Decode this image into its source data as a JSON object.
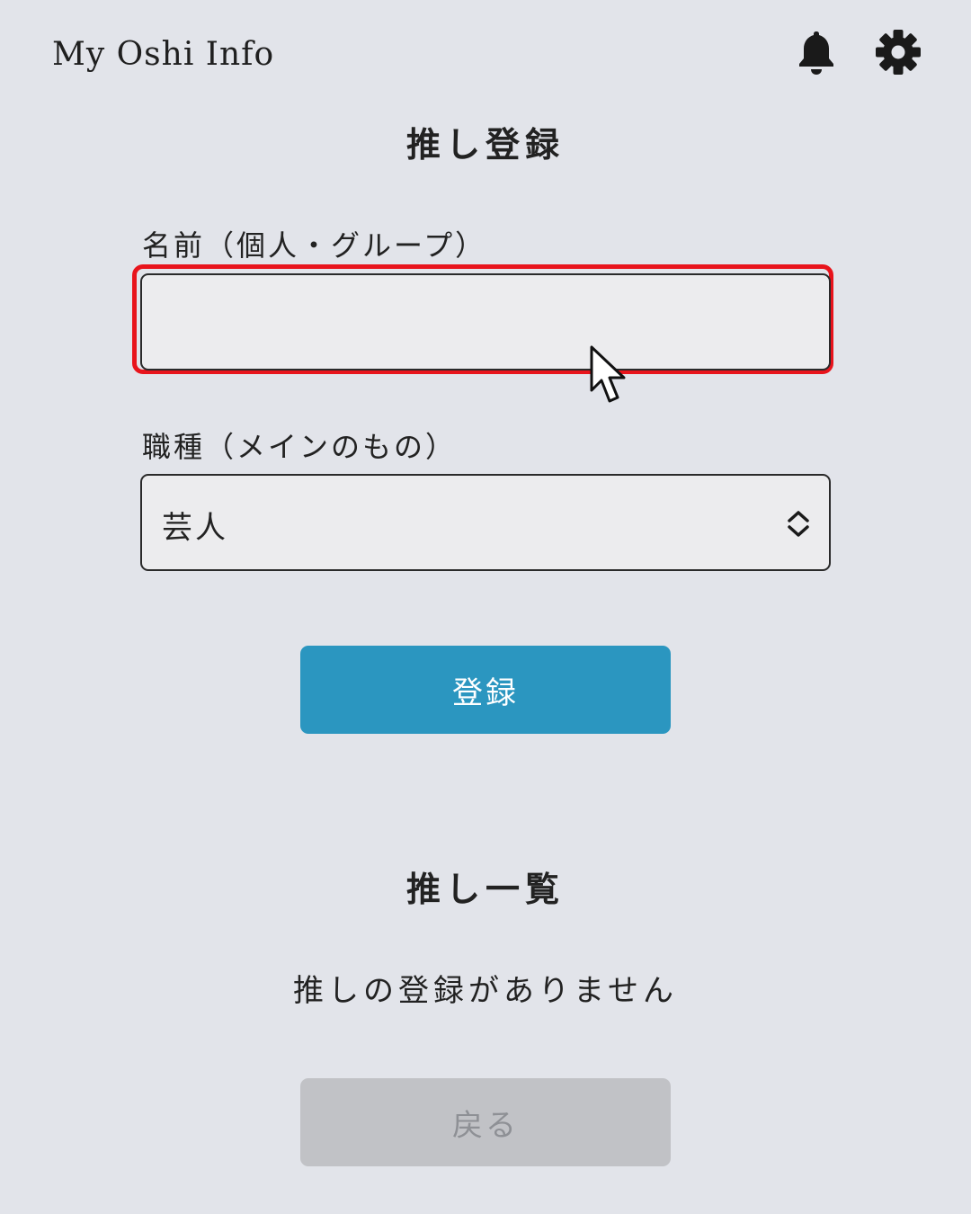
{
  "header": {
    "app_title": "My Oshi Info",
    "icons": [
      "bell-icon",
      "gear-icon"
    ]
  },
  "register_section": {
    "title": "推し登録",
    "name_label": "名前（個人・グループ）",
    "name_value": "",
    "job_label": "職種（メインのもの）",
    "job_selected": "芸人",
    "submit_label": "登録"
  },
  "list_section": {
    "title": "推し一覧",
    "empty_message": "推しの登録がありません",
    "back_label": "戻る"
  },
  "colors": {
    "background": "#e2e4ea",
    "primary_button": "#2b96c0",
    "disabled_button": "#c1c2c6",
    "highlight": "#e8141c"
  }
}
